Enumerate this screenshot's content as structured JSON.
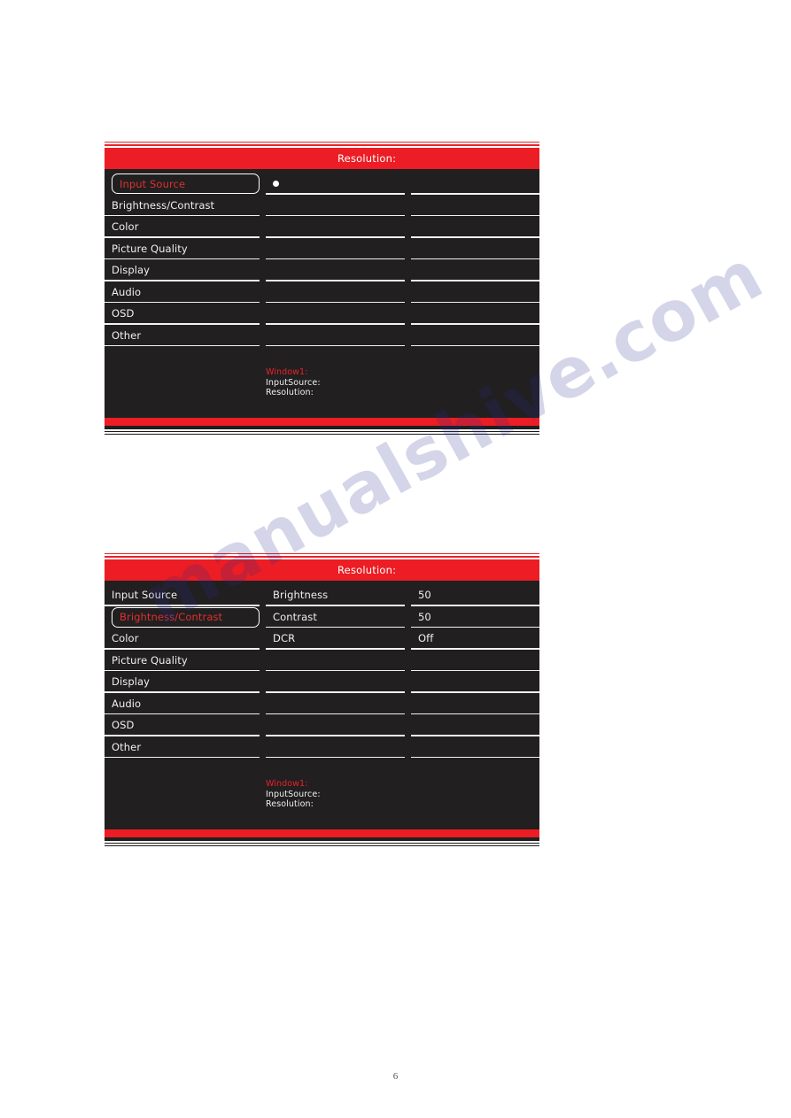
{
  "page": {
    "number": "6",
    "watermark": "manualshive.com"
  },
  "panels": [
    {
      "id": "osd-input-source",
      "header_title": "Resolution:",
      "selected_index": 0,
      "rows": [
        {
          "label": "Input Source",
          "middle": "",
          "value": "",
          "marker": "dot"
        },
        {
          "label": "Brightness/Contrast",
          "middle": "",
          "value": "",
          "marker": ""
        },
        {
          "label": "Color",
          "middle": "",
          "value": "",
          "marker": ""
        },
        {
          "label": "Picture Quality",
          "middle": "",
          "value": "",
          "marker": ""
        },
        {
          "label": "Display",
          "middle": "",
          "value": "",
          "marker": ""
        },
        {
          "label": "Audio",
          "middle": "",
          "value": "",
          "marker": ""
        },
        {
          "label": "OSD",
          "middle": "",
          "value": "",
          "marker": ""
        },
        {
          "label": "Other",
          "middle": "",
          "value": "",
          "marker": ""
        }
      ],
      "info": {
        "window": "Window1:",
        "input_source": "InputSource:",
        "resolution": "Resolution:"
      }
    },
    {
      "id": "osd-brightness-contrast",
      "header_title": "Resolution:",
      "selected_index": 1,
      "rows": [
        {
          "label": "Input Source",
          "middle": "Brightness",
          "value": "50",
          "marker": ""
        },
        {
          "label": "Brightness/Contrast",
          "middle": "Contrast",
          "value": "50",
          "marker": ""
        },
        {
          "label": "Color",
          "middle": "DCR",
          "value": "Off",
          "marker": ""
        },
        {
          "label": "Picture Quality",
          "middle": "",
          "value": "",
          "marker": ""
        },
        {
          "label": "Display",
          "middle": "",
          "value": "",
          "marker": ""
        },
        {
          "label": "Audio",
          "middle": "",
          "value": "",
          "marker": ""
        },
        {
          "label": "OSD",
          "middle": "",
          "value": "",
          "marker": ""
        },
        {
          "label": "Other",
          "middle": "",
          "value": "",
          "marker": ""
        }
      ],
      "info": {
        "window": "Window1:",
        "input_source": "InputSource:",
        "resolution": "Resolution:"
      }
    }
  ],
  "colors": {
    "accent_red": "#ec1d24",
    "panel_bg": "#211f20",
    "text": "#f0f0f0",
    "selected_text": "#e03030"
  }
}
